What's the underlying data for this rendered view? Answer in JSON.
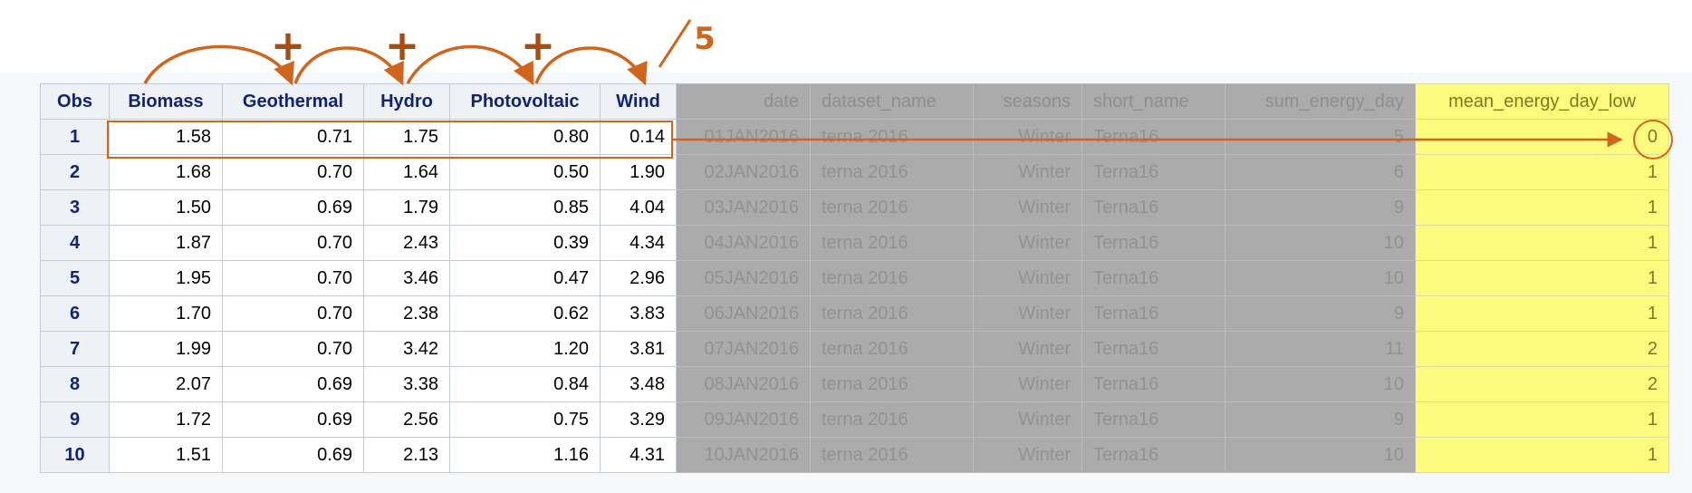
{
  "columns": [
    {
      "key": "obs",
      "label": "Obs"
    },
    {
      "key": "biomass",
      "label": "Biomass"
    },
    {
      "key": "geothermal",
      "label": "Geothermal"
    },
    {
      "key": "hydro",
      "label": "Hydro"
    },
    {
      "key": "photovoltaic",
      "label": "Photovoltaic"
    },
    {
      "key": "wind",
      "label": "Wind"
    },
    {
      "key": "date",
      "label": "date"
    },
    {
      "key": "dataset_name",
      "label": "dataset_name"
    },
    {
      "key": "seasons",
      "label": "seasons"
    },
    {
      "key": "short_name",
      "label": "short_name"
    },
    {
      "key": "sum_energy_day",
      "label": "sum_energy_day"
    },
    {
      "key": "mean_energy_day_low",
      "label": "mean_energy_day_low"
    }
  ],
  "rows": [
    [
      "1",
      "1.58",
      "0.71",
      "1.75",
      "0.80",
      "0.14",
      "01JAN2016",
      "terna 2016",
      "Winter",
      "Terna16",
      "5",
      "0"
    ],
    [
      "2",
      "1.68",
      "0.70",
      "1.64",
      "0.50",
      "1.90",
      "02JAN2016",
      "terna 2016",
      "Winter",
      "Terna16",
      "6",
      "1"
    ],
    [
      "3",
      "1.50",
      "0.69",
      "1.79",
      "0.85",
      "4.04",
      "03JAN2016",
      "terna 2016",
      "Winter",
      "Terna16",
      "9",
      "1"
    ],
    [
      "4",
      "1.87",
      "0.70",
      "2.43",
      "0.39",
      "4.34",
      "04JAN2016",
      "terna 2016",
      "Winter",
      "Terna16",
      "10",
      "1"
    ],
    [
      "5",
      "1.95",
      "0.70",
      "3.46",
      "0.47",
      "2.96",
      "05JAN2016",
      "terna 2016",
      "Winter",
      "Terna16",
      "10",
      "1"
    ],
    [
      "6",
      "1.70",
      "0.70",
      "2.38",
      "0.62",
      "3.83",
      "06JAN2016",
      "terna 2016",
      "Winter",
      "Terna16",
      "9",
      "1"
    ],
    [
      "7",
      "1.99",
      "0.70",
      "3.42",
      "1.20",
      "3.81",
      "07JAN2016",
      "terna 2016",
      "Winter",
      "Terna16",
      "11",
      "2"
    ],
    [
      "8",
      "2.07",
      "0.69",
      "3.38",
      "0.84",
      "3.48",
      "08JAN2016",
      "terna 2016",
      "Winter",
      "Terna16",
      "10",
      "2"
    ],
    [
      "9",
      "1.72",
      "0.69",
      "2.56",
      "0.75",
      "3.29",
      "09JAN2016",
      "terna 2016",
      "Winter",
      "Terna16",
      "9",
      "1"
    ],
    [
      "10",
      "1.51",
      "0.69",
      "2.13",
      "1.16",
      "4.31",
      "10JAN2016",
      "terna 2016",
      "Winter",
      "Terna16",
      "10",
      "1"
    ]
  ],
  "annotations": {
    "plus_symbols": [
      "+",
      "+",
      "+"
    ],
    "divisor_label": "5"
  },
  "colors": {
    "annotation": "#d0661e",
    "highlight_column": "#fcfb7e",
    "dimmed_columns": "#ababab",
    "header_text": "#112277"
  }
}
